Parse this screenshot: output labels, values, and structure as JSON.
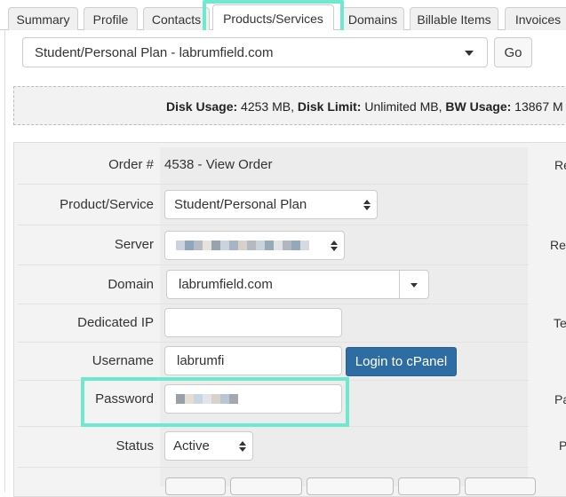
{
  "tabs": [
    {
      "label": "Summary"
    },
    {
      "label": "Profile"
    },
    {
      "label": "Contacts"
    },
    {
      "label": "Products/Services",
      "active": true
    },
    {
      "label": "Domains"
    },
    {
      "label": "Billable Items"
    },
    {
      "label": "Invoices"
    }
  ],
  "service_select": {
    "value": "Student/Personal Plan - labrumfield.com"
  },
  "go_button": "Go",
  "usage": {
    "disk_usage_label": "Disk Usage:",
    "disk_usage_value": "4253 MB,",
    "disk_limit_label": "Disk Limit:",
    "disk_limit_value": "Unlimited MB,",
    "bw_usage_label": "BW Usage:",
    "bw_usage_value": "13867 M"
  },
  "form": {
    "order_label": "Order #",
    "order_value": "4538 - View Order",
    "product_label": "Product/Service",
    "product_value": "Student/Personal Plan",
    "server_label": "Server",
    "domain_label": "Domain",
    "domain_value": "labrumfield.com",
    "dedicated_ip_label": "Dedicated IP",
    "dedicated_ip_value": "",
    "username_label": "Username",
    "username_value": "labrumfi",
    "cpanel_button": "Login to cPanel",
    "password_label": "Password",
    "status_label": "Status",
    "status_value": "Active"
  },
  "right_labels": [
    "Re",
    "Rec",
    "Te",
    "Pa",
    "P"
  ],
  "colors": {
    "highlight": "#6ee9d0",
    "primary_button": "#2e6da4"
  }
}
